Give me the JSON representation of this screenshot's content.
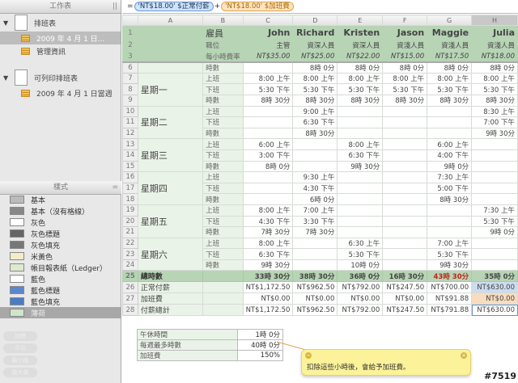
{
  "sidebar": {
    "sheets_header": "工作表",
    "sheets": [
      {
        "name": "排班表",
        "tables": [
          "2009 年 4 月 1 日...",
          "管理資訊"
        ]
      },
      {
        "name": "可列印排班表",
        "tables": [
          "2009 年 4 月 1 日當週"
        ]
      }
    ],
    "styles_header": "樣式",
    "styles": [
      {
        "label": "基本",
        "c": "#bbb"
      },
      {
        "label": "基本（沒有格線）",
        "c": "#888"
      },
      {
        "label": "灰色",
        "c": "#fff"
      },
      {
        "label": "灰色標題",
        "c": "#666"
      },
      {
        "label": "灰色填充",
        "c": "#777"
      },
      {
        "label": "米黃色",
        "c": "#f3ecc8"
      },
      {
        "label": "帳目報表紙（Ledger）",
        "c": "#dfe8d0"
      },
      {
        "label": "藍色",
        "c": "#fff"
      },
      {
        "label": "藍色標題",
        "c": "#5b88cc"
      },
      {
        "label": "藍色填充",
        "c": "#4a7cc5"
      },
      {
        "label": "薄荷",
        "c": "#cfe5cc"
      }
    ],
    "function_buttons": [
      "加總",
      "平均",
      "最小值",
      "最大值"
    ]
  },
  "formula": {
    "eq": "=",
    "token1": "'NT$18.00' $正常付薪",
    "plus": "+",
    "token2": "'NT$18.00' $加班費"
  },
  "columns": [
    "A",
    "B",
    "C",
    "D",
    "E",
    "F",
    "G",
    "H"
  ],
  "header_rows": [
    {
      "num": "1",
      "b": "雇員",
      "vals": [
        "John",
        "Richard",
        "Kristen",
        "Jason",
        "Maggie",
        "Julia"
      ]
    },
    {
      "num": "2",
      "b": "職位",
      "vals": [
        "主管",
        "資深人員",
        "資深人員",
        "資淺人員",
        "資淺人員",
        "資淺人員"
      ]
    },
    {
      "num": "3",
      "b": "每小時費率",
      "vals": [
        "NT$35.00",
        "NT$25.00",
        "NT$22.00",
        "NT$15.00",
        "NT$17.50",
        "NT$18.00"
      ]
    }
  ],
  "body_rows": [
    {
      "num": "6",
      "a": "",
      "b": "時數",
      "vals": [
        "",
        "8時 0分",
        "8時 0分",
        "8時 0分",
        "8時 0分",
        "8時 0分"
      ]
    },
    {
      "num": "7",
      "a": "星期一",
      "span": 3,
      "b": "上班",
      "vals": [
        "8:00 上午",
        "8:00 上午",
        "8:00 上午",
        "8:00 上午",
        "8:00 上午",
        "8:00 上午"
      ]
    },
    {
      "num": "8",
      "b": "下班",
      "vals": [
        "5:30 下午",
        "5:30 下午",
        "5:30 下午",
        "5:30 下午",
        "5:30 下午",
        "5:30 下午"
      ]
    },
    {
      "num": "9",
      "b": "時數",
      "vals": [
        "8時 30分",
        "8時 30分",
        "8時 30分",
        "8時 30分",
        "8時 30分",
        "8時 30分"
      ]
    },
    {
      "num": "10",
      "a": "星期二",
      "span": 3,
      "b": "上班",
      "vals": [
        "",
        "9:00 上午",
        "",
        "",
        "",
        "8:30 上午"
      ]
    },
    {
      "num": "11",
      "b": "下班",
      "vals": [
        "",
        "6:30 下午",
        "",
        "",
        "",
        "7:00 下午"
      ]
    },
    {
      "num": "12",
      "b": "時數",
      "vals": [
        "",
        "8時 30分",
        "",
        "",
        "",
        "9時 30分"
      ]
    },
    {
      "num": "13",
      "a": "星期三",
      "span": 3,
      "b": "上班",
      "vals": [
        "6:00 上午",
        "",
        "8:00 上午",
        "",
        "6:00 上午",
        ""
      ]
    },
    {
      "num": "14",
      "b": "下班",
      "vals": [
        "3:00 下午",
        "",
        "6:30 下午",
        "",
        "4:00 下午",
        ""
      ]
    },
    {
      "num": "15",
      "b": "時數",
      "vals": [
        "8時 0分",
        "",
        "9時 30分",
        "",
        "9時 0分",
        ""
      ]
    },
    {
      "num": "16",
      "a": "星期四",
      "span": 3,
      "b": "上班",
      "vals": [
        "",
        "9:30 上午",
        "",
        "",
        "7:30 上午",
        ""
      ]
    },
    {
      "num": "17",
      "b": "下班",
      "vals": [
        "",
        "4:30 下午",
        "",
        "",
        "5:00 下午",
        ""
      ]
    },
    {
      "num": "18",
      "b": "時數",
      "vals": [
        "",
        "6時 0分",
        "",
        "",
        "8時 30分",
        ""
      ]
    },
    {
      "num": "19",
      "a": "星期五",
      "span": 3,
      "b": "上班",
      "vals": [
        "8:00 上午",
        "7:00 上午",
        "",
        "",
        "",
        "7:30 上午"
      ]
    },
    {
      "num": "20",
      "b": "下班",
      "vals": [
        "4:30 下午",
        "3:30 下午",
        "",
        "",
        "",
        "5:30 下午"
      ]
    },
    {
      "num": "21",
      "b": "時數",
      "vals": [
        "7時 30分",
        "7時 30分",
        "",
        "",
        "",
        "9時 0分"
      ]
    },
    {
      "num": "22",
      "a": "星期六",
      "span": 3,
      "b": "上班",
      "vals": [
        "8:00 上午",
        "",
        "6:30 上午",
        "",
        "7:00 上午",
        ""
      ]
    },
    {
      "num": "23",
      "b": "下班",
      "vals": [
        "6:30 下午",
        "",
        "5:30 下午",
        "",
        "5:30 下午",
        ""
      ]
    },
    {
      "num": "24",
      "b": "時數",
      "vals": [
        "9時 30分",
        "",
        "10時 0分",
        "",
        "9時 30分",
        ""
      ]
    }
  ],
  "total_row": {
    "num": "25",
    "a": "總時數",
    "vals": [
      "33時 30分",
      "38時 30分",
      "36時 0分",
      "16時 30分",
      "43時 30分",
      "35時 0分"
    ],
    "highlight_index": 4,
    "highlight_color": "#c0241a"
  },
  "summary_rows": [
    {
      "num": "26",
      "a": "正常付薪",
      "vals": [
        "NT$1,172.50",
        "NT$962.50",
        "NT$792.00",
        "NT$247.50",
        "NT$700.00",
        "NT$630.00"
      ]
    },
    {
      "num": "27",
      "a": "加班費",
      "vals": [
        "NT$0.00",
        "NT$0.00",
        "NT$0.00",
        "NT$0.00",
        "NT$91.88",
        "NT$0.00"
      ]
    },
    {
      "num": "28",
      "a": "付薪總計",
      "vals": [
        "NT$1,172.50",
        "NT$962.50",
        "NT$792.00",
        "NT$247.50",
        "NT$791.88",
        "NT$630.00"
      ]
    }
  ],
  "management": [
    {
      "label": "午休時間",
      "value": "1時 0分"
    },
    {
      "label": "每週最多時數",
      "value": "40時 0分"
    },
    {
      "label": "加班費",
      "value": "150%"
    }
  ],
  "comment": {
    "text": "扣除這些小時後，會給予加班費。"
  },
  "watermark": "#7519"
}
